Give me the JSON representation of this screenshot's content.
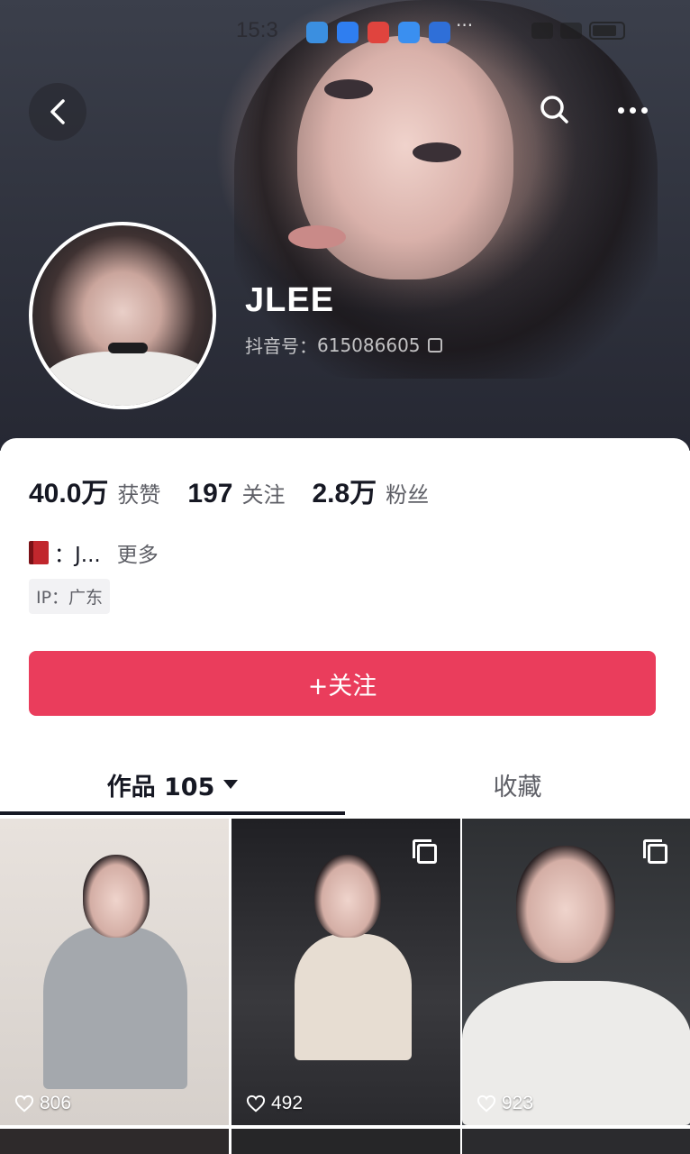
{
  "status_bar": {
    "time": "15:3",
    "app_icon_colors": [
      "#3b8fe0",
      "#2f7ef0",
      "#e0443e",
      "#3a8ff0",
      "#2f6fd8"
    ],
    "more": "···"
  },
  "header": {
    "back_icon": "chevron-left-icon",
    "search_icon": "search-icon",
    "more_icon": "more-horizontal-icon"
  },
  "profile": {
    "username": "JLEE",
    "douyin_id_label": "抖音号：",
    "douyin_id": "615086605"
  },
  "stats": [
    {
      "num": "40.0万",
      "label": "获赞"
    },
    {
      "num": "197",
      "label": "关注"
    },
    {
      "num": "2.8万",
      "label": "粉丝"
    }
  ],
  "bio": {
    "icon": "red-book-icon",
    "text": "：J...",
    "more": "更多"
  },
  "ip_tag": "IP：广东",
  "follow_button": "+关注",
  "tabs": {
    "works": "作品 105",
    "collect": "收藏"
  },
  "videos": [
    {
      "likes": "806",
      "multi": false
    },
    {
      "likes": "492",
      "multi": true
    },
    {
      "likes": "923",
      "multi": true
    }
  ],
  "colors": {
    "accent": "#ea3d5c",
    "text_primary": "#161823",
    "text_secondary": "#5e5f66"
  }
}
